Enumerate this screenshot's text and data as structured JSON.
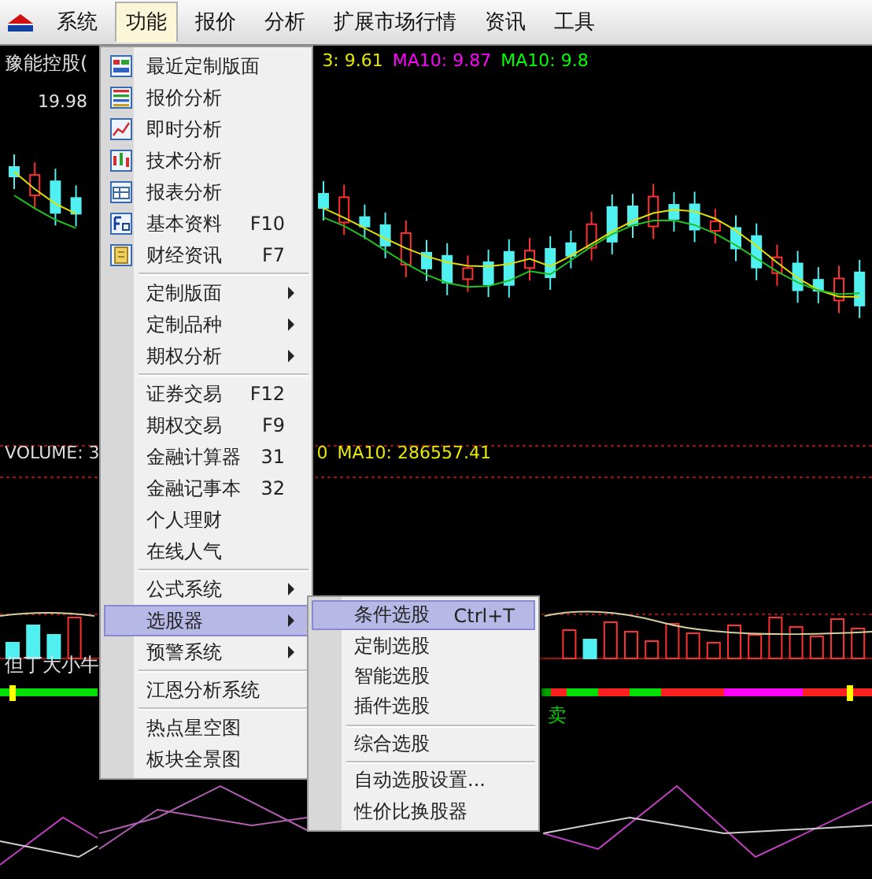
{
  "menubar": [
    {
      "label": "系统",
      "selected": false
    },
    {
      "label": "功能",
      "selected": true
    },
    {
      "label": "报价",
      "selected": false
    },
    {
      "label": "分析",
      "selected": false
    },
    {
      "label": "扩展市场行情",
      "selected": false
    },
    {
      "label": "资讯",
      "selected": false
    },
    {
      "label": "工具",
      "selected": false
    }
  ],
  "price_panel": {
    "stock": "豫能控股(",
    "readouts": [
      {
        "text": "3: 9.61",
        "color": "#e8e800"
      },
      {
        "text": "MA10: 9.87",
        "color": "#ff00ff"
      },
      {
        "text": "MA10: 9.8",
        "color": "#00ff00"
      }
    ],
    "price_label": "19.98"
  },
  "volume_panel": {
    "title": "VOLUME: 3",
    "readouts": [
      {
        "text": "0",
        "color": "#e8e800"
      },
      {
        "text": "MA10: 286557.41",
        "color": "#e8e800"
      }
    ]
  },
  "indicator_panel": {
    "title": "但丁大小牛",
    "signal": "卖"
  },
  "menu": {
    "items": [
      {
        "kind": "item",
        "label": "最近定制版面",
        "icon": true,
        "submenu": false,
        "selected": false
      },
      {
        "kind": "item",
        "label": "报价分析",
        "icon": true,
        "submenu": false,
        "selected": false
      },
      {
        "kind": "item",
        "label": "即时分析",
        "icon": true,
        "submenu": false,
        "selected": false
      },
      {
        "kind": "item",
        "label": "技术分析",
        "icon": true,
        "submenu": false,
        "selected": false
      },
      {
        "kind": "item",
        "label": "报表分析",
        "icon": true,
        "submenu": false,
        "selected": false
      },
      {
        "kind": "item",
        "label": "基本资料",
        "shortcut": "F10",
        "icon": true,
        "submenu": false,
        "selected": false
      },
      {
        "kind": "item",
        "label": "财经资讯",
        "shortcut": "F7",
        "icon": true,
        "submenu": false,
        "selected": false
      },
      {
        "kind": "separator"
      },
      {
        "kind": "item",
        "label": "定制版面",
        "icon": false,
        "submenu": true,
        "selected": false
      },
      {
        "kind": "item",
        "label": "定制品种",
        "icon": false,
        "submenu": true,
        "selected": false
      },
      {
        "kind": "item",
        "label": "期权分析",
        "icon": false,
        "submenu": true,
        "selected": false
      },
      {
        "kind": "separator"
      },
      {
        "kind": "item",
        "label": "证券交易",
        "shortcut": "F12",
        "icon": false,
        "submenu": false,
        "selected": false
      },
      {
        "kind": "item",
        "label": "期权交易",
        "shortcut": "F9",
        "icon": false,
        "submenu": false,
        "selected": false
      },
      {
        "kind": "item",
        "label": "金融计算器",
        "shortcut": "31",
        "icon": false,
        "submenu": false,
        "selected": false
      },
      {
        "kind": "item",
        "label": "金融记事本",
        "shortcut": "32",
        "icon": false,
        "submenu": false,
        "selected": false
      },
      {
        "kind": "item",
        "label": "个人理财",
        "icon": false,
        "submenu": false,
        "selected": false
      },
      {
        "kind": "item",
        "label": "在线人气",
        "icon": false,
        "submenu": false,
        "selected": false
      },
      {
        "kind": "separator"
      },
      {
        "kind": "item",
        "label": "公式系统",
        "icon": false,
        "submenu": true,
        "selected": false
      },
      {
        "kind": "item",
        "label": "选股器",
        "icon": false,
        "submenu": true,
        "selected": true
      },
      {
        "kind": "item",
        "label": "预警系统",
        "icon": false,
        "submenu": true,
        "selected": false
      },
      {
        "kind": "separator"
      },
      {
        "kind": "item",
        "label": "江恩分析系统",
        "icon": false,
        "submenu": false,
        "selected": false
      },
      {
        "kind": "separator"
      },
      {
        "kind": "item",
        "label": "热点星空图",
        "icon": false,
        "submenu": false,
        "selected": false
      },
      {
        "kind": "item",
        "label": "板块全景图",
        "icon": false,
        "submenu": false,
        "selected": false
      }
    ]
  },
  "submenu": {
    "items": [
      {
        "kind": "item",
        "label": "条件选股",
        "shortcut": "Ctrl+T",
        "selected": true
      },
      {
        "kind": "item",
        "label": "定制选股",
        "selected": false
      },
      {
        "kind": "item",
        "label": "智能选股",
        "selected": false
      },
      {
        "kind": "item",
        "label": "插件选股",
        "selected": false
      },
      {
        "kind": "separator"
      },
      {
        "kind": "item",
        "label": "综合选股",
        "selected": false
      },
      {
        "kind": "separator"
      },
      {
        "kind": "item",
        "label": "自动选股设置...",
        "selected": false
      },
      {
        "kind": "item",
        "label": "性价比换股器",
        "selected": false
      }
    ]
  }
}
